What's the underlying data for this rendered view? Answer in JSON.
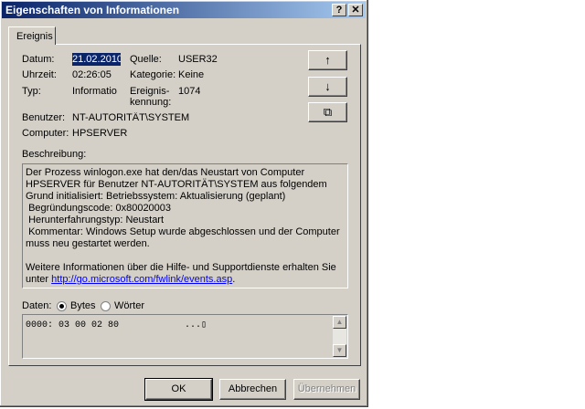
{
  "window": {
    "title": "Eigenschaften von Informationen",
    "help_button": "?",
    "close_button": "✕"
  },
  "tabs": [
    {
      "label": "Ereignis"
    }
  ],
  "fields": {
    "datum_label": "Datum:",
    "datum_value": "21.02.2010",
    "uhrzeit_label": "Uhrzeit:",
    "uhrzeit_value": "02:26:05",
    "typ_label": "Typ:",
    "typ_value": "Informatio",
    "benutzer_label": "Benutzer:",
    "benutzer_value": "NT-AUTORITÄT\\SYSTEM",
    "computer_label": "Computer:",
    "computer_value": "HPSERVER",
    "quelle_label": "Quelle:",
    "quelle_value": "USER32",
    "kategorie_label": "Kategorie:",
    "kategorie_value": "Keine",
    "ereignis_label_1": "Ereignis-",
    "ereignis_label_2": "kennung:",
    "ereignis_value": "1074"
  },
  "side_buttons": {
    "up": "↑",
    "down": "↓",
    "copy": "⧉"
  },
  "description": {
    "label": "Beschreibung:",
    "text": "Der Prozess winlogon.exe hat den/das Neustart von Computer\nHPSERVER für Benutzer NT-AUTORITÄT\\SYSTEM aus folgendem\nGrund initialisiert: Betriebssystem: Aktualisierung (geplant)\n Begründungscode: 0x80020003\n Herunterfahrungstyp: Neustart\n Kommentar: Windows Setup wurde abgeschlossen und der Computer\nmuss neu gestartet werden.\n\nWeitere Informationen über die Hilfe- und Supportdienste erhalten Sie\nunter ",
    "link": "http://go.microsoft.com/fwlink/events.asp",
    "after_link": "."
  },
  "data_section": {
    "label": "Daten:",
    "option_bytes": "Bytes",
    "option_words": "Wörter",
    "selected": "Bytes",
    "hex_line": "0000: 03 00 02 80            ...▯"
  },
  "buttons": {
    "ok": "OK",
    "cancel": "Abbrechen",
    "apply": "Übernehmen"
  },
  "colors": {
    "titlebar_start": "#0a246a",
    "titlebar_end": "#a6caf0",
    "face": "#d4d0c8",
    "link": "#0000ff"
  }
}
